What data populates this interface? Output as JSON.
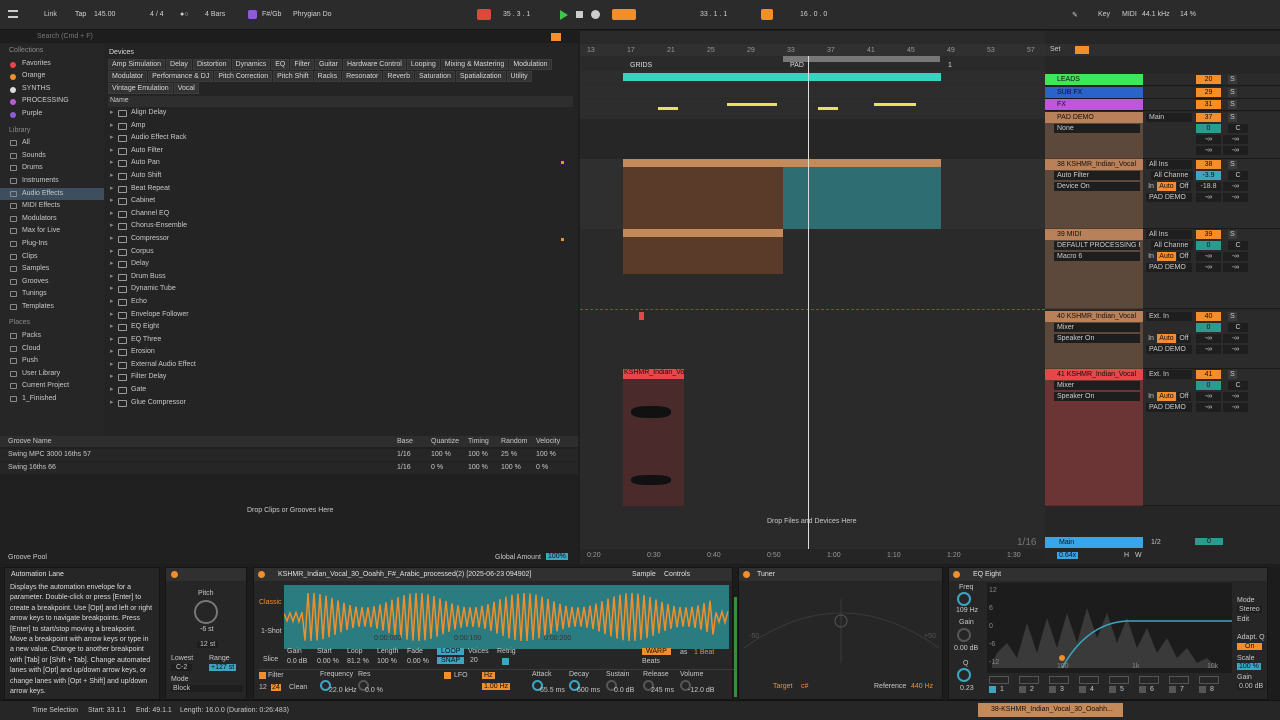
{
  "topbar": {
    "link": "Link",
    "tap": "Tap",
    "tempo": "145.00",
    "meter": "4 / 4",
    "bars": "4 Bars",
    "key_root": "F#/Gb",
    "scale": "Phrygian Do",
    "position": "35 .  3 .  1",
    "loop_start": "33 .  1 .  1",
    "loop_len": "16 .  0 .  0",
    "key": "Key",
    "midi": "MIDI",
    "sr": "44.1 kHz",
    "cpu": "14 %"
  },
  "browser": {
    "search_placeholder": "Search (Cmd + F)",
    "devices_label": "Devices",
    "name_col": "Name",
    "collections_hdr": "Collections",
    "collections": [
      {
        "label": "Favorites",
        "color": "#e44"
      },
      {
        "label": "Orange",
        "color": "#f28e2b"
      },
      {
        "label": "SYNTHS",
        "color": "#ddd"
      },
      {
        "label": "PROCESSING",
        "color": "#bb5ad8"
      },
      {
        "label": "Purple",
        "color": "#8e5ad8"
      }
    ],
    "library_hdr": "Library",
    "library": [
      "All",
      "Sounds",
      "Drums",
      "Instruments",
      "Audio Effects",
      "MIDI Effects",
      "Modulators",
      "Max for Live",
      "Plug-Ins",
      "Clips",
      "Samples",
      "Grooves",
      "Tunings",
      "Templates"
    ],
    "places_hdr": "Places",
    "places": [
      "Packs",
      "Cloud",
      "Push",
      "User Library",
      "Current Project",
      "1_Finished"
    ],
    "tags": [
      "Amp Simulation",
      "Delay",
      "Distortion",
      "Dynamics",
      "EQ",
      "Filter",
      "Guitar",
      "Hardware Control",
      "Looping",
      "Mixing & Mastering",
      "Modulation",
      "Modulator",
      "Performance & DJ",
      "Pitch Correction",
      "Pitch Shift",
      "Racks",
      "Resonator",
      "Reverb",
      "Saturation",
      "Spatialization",
      "Utility",
      "Vintage Emulation",
      "Vocal"
    ],
    "items": [
      "Align Delay",
      "Amp",
      "Audio Effect Rack",
      "Auto Filter",
      "Auto Pan",
      "Auto Shift",
      "Beat Repeat",
      "Cabinet",
      "Channel EQ",
      "Chorus-Ensemble",
      "Compressor",
      "Corpus",
      "Delay",
      "Drum Buss",
      "Dynamic Tube",
      "Echo",
      "Envelope Follower",
      "EQ Eight",
      "EQ Three",
      "Erosion",
      "External Audio Effect",
      "Filter Delay",
      "Gate",
      "Glue Compressor"
    ]
  },
  "groove": {
    "headers": [
      "Groove Name",
      "Base",
      "Quantize",
      "Timing",
      "Random",
      "Velocity"
    ],
    "rows": [
      [
        "Swing MPC 3000 16ths 57",
        "1/16",
        "100 %",
        "100 %",
        "25 %",
        "100 %"
      ],
      [
        "Swing 16ths 66",
        "1/16",
        "0 %",
        "100 %",
        "100 %",
        "0 %"
      ]
    ],
    "drop": "Drop Clips or Grooves Here",
    "pool": "Groove Pool",
    "global_amount": "Global Amount",
    "global_value": "100%"
  },
  "arrangement": {
    "bars": [
      "13",
      "17",
      "21",
      "25",
      "29",
      "33",
      "37",
      "41",
      "45",
      "49",
      "53",
      "57"
    ],
    "times": [
      "0:20",
      "0:30",
      "0:40",
      "0:50",
      "1:00",
      "1:10",
      "1:20",
      "1:30"
    ],
    "grids": "GRIDS",
    "pad": "PAD",
    "loop_end": "1",
    "clip_name": "KSHMR_Indian_Vo",
    "drop": "Drop Files and Devices Here",
    "zoom": "1/16"
  },
  "mixer": {
    "set": "Set",
    "tracks": [
      {
        "name": "LEADS",
        "color": "#3ee65a",
        "num": "20"
      },
      {
        "name": "SUB FX",
        "color": "#2a63c9",
        "num": "29"
      },
      {
        "name": "FX",
        "color": "#bb5ad8",
        "num": "31"
      },
      {
        "name": "PAD DEMO",
        "color": "#b9815a",
        "num": "37",
        "device": "None",
        "route": "Main"
      },
      {
        "name": "38 KSHMR_Indian_Vocal",
        "color": "#b9815a",
        "num": "38",
        "dev1": "Auto Filter",
        "dev2": "Device On",
        "in": "All Ins",
        "ch": "All Channe",
        "vol": "-3.9",
        "send": "-18.8",
        "out": "PAD DEMO"
      },
      {
        "name": "39 MIDI",
        "color": "#b9815a",
        "num": "39",
        "dev1": "DEFAULT PROCESSING R",
        "dev2": "Macro 6",
        "in": "All Ins",
        "ch": "All Channe",
        "out": "PAD DEMO"
      },
      {
        "name": "40 KSHMR_Indian_Vocal",
        "color": "#b9815a",
        "num": "40",
        "dev1": "Mixer",
        "dev2": "Speaker On",
        "in": "Ext. In",
        "out": "PAD DEMO"
      },
      {
        "name": "41 KSHMR_Indian_Vocal",
        "color": "#e44848",
        "num": "41",
        "dev1": "Mixer",
        "dev2": "Speaker On",
        "in": "Ext. In",
        "out": "PAD DEMO"
      }
    ],
    "main": "Main",
    "main_vol": "0.64x",
    "main_ratio": "1/2",
    "main_num": "0",
    "in_label": "In",
    "auto_label": "Auto",
    "off_label": "Off",
    "s": "S",
    "c": "C",
    "inf": "-∞",
    "zero": "0",
    "h": "H",
    "w": "W"
  },
  "info": {
    "title": "Automation Lane",
    "body": "Displays the automation envelope for a parameter. Double-click or press [Enter] to create a breakpoint. Use [Opt] and left or right arrow keys to navigate breakpoints. Press [Enter] to start/stop moving a breakpoint. Move a breakpoint with arrow keys or type in a new value. Change to another breakpoint with [Tab] or [Shift + Tab]. Change automated lanes with [Opt] and up/down arrow keys, or change lanes with [Opt + Shift] and up/down arrow keys."
  },
  "pitch": {
    "label": "Pitch",
    "value": "-6 st",
    "range_val": "12 st",
    "lowest": "Lowest",
    "range": "Range",
    "low_val": "C-2",
    "high_val": "+127 st",
    "mode": "Mode",
    "mode_val": "Block"
  },
  "sampler": {
    "title": "KSHMR_Indian_Vocal_30_Ooahh_F#_Arabic_processed(2) [2025-06-23 094902]",
    "tab1": "Sample",
    "tab2": "Controls",
    "classic": "Classic",
    "oneshot": "1-Shot",
    "slice": "Slice",
    "params": [
      [
        "Gain",
        "0.0 dB"
      ],
      [
        "Start",
        "0.00 %"
      ],
      [
        "Loop",
        "81.2 %"
      ],
      [
        "Length",
        "100 %"
      ],
      [
        "Fade",
        "0.00 %"
      ]
    ],
    "loop": "LOOP",
    "snap": "SNAP",
    "voices": "Voices",
    "voices_val": "20",
    "retrig": "Retrig",
    "warp": "WARP",
    "as": "as",
    "beat": "1 Beat",
    "beats": "Beats",
    "filter": "Filter",
    "f12": "12",
    "f24": "24",
    "clean": "Clean",
    "freq": "Frequency",
    "freq_val": "22.0 kHz",
    "res": "Res",
    "res_val": "0.0 %",
    "lfo": "LFO",
    "hz": "Hz",
    "lfo_val": "1.00 Hz",
    "attack": "Attack",
    "attack_val": "65.5 ms",
    "decay": "Decay",
    "decay_val": "600 ms",
    "sustain": "Sustain",
    "sustain_val": "0.0 dB",
    "release": "Release",
    "release_val": "245 ms",
    "volume": "Volume",
    "volume_val": "-12.0 dB",
    "t1": "0:00:000",
    "t2": "0:00:100",
    "t3": "0:00:200"
  },
  "tuner": {
    "title": "Tuner",
    "left": "-50",
    "right": "+50",
    "target": "Target",
    "note": "c#",
    "ref": "Reference",
    "ref_val": "440 Hz"
  },
  "eq": {
    "title": "EQ Eight",
    "freq": "Freq",
    "freq_val": "109 Hz",
    "gain": "Gain",
    "gain_val": "0.00 dB",
    "q": "Q",
    "q_val": "0.23",
    "mode": "Mode",
    "mode_val": "Stereo",
    "edit": "Edit",
    "adapt": "Adapt. Q",
    "on": "On",
    "scale": "Scale",
    "scale_val": "100 %",
    "gain2": "Gain",
    "gain2_val": "0.00 dB",
    "db": [
      "12",
      "6",
      "0",
      "-6",
      "-12"
    ],
    "hz": [
      "100",
      "1k",
      "10k"
    ],
    "bands": [
      "1",
      "2",
      "3",
      "4",
      "5",
      "6",
      "7",
      "8"
    ]
  },
  "status": {
    "mode": "Time Selection",
    "start": "Start: 33.1.1",
    "end": "End: 49.1.1",
    "length": "Length: 16.0.0 (Duration: 0:26:483)",
    "track": "38-KSHMR_Indian_Vocal_30_Ooahh..."
  }
}
